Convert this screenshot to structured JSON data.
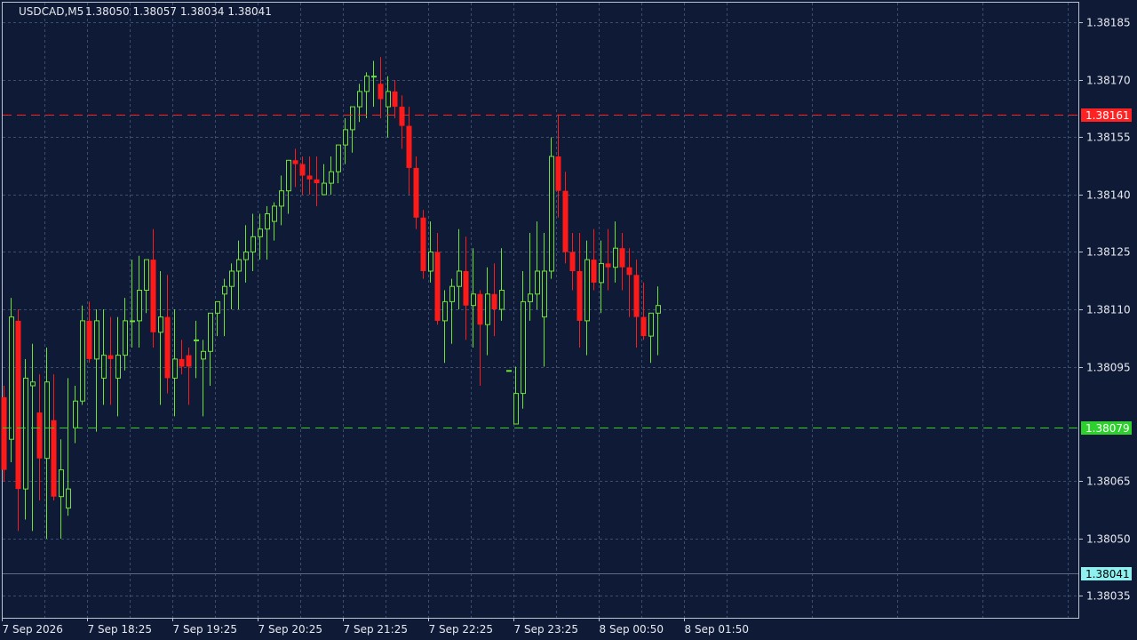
{
  "header": {
    "symbol_timeframe": "USDCAD,M5",
    "ohlc": "1.38050 1.38057 1.38034 1.38041"
  },
  "colors": {
    "background": "#0f1a36",
    "grid": "#3a4f6e",
    "frame": "#b8c4d0",
    "bull": "#6fe23a",
    "bear": "#ff1a1a",
    "ask_line": "#ff2222",
    "bid_line": "#2ed02e",
    "last_label": "#8ff0f0"
  },
  "chart_data": {
    "type": "candlestick",
    "symbol": "USDCAD",
    "timeframe": "M5",
    "ylim": [
      1.3803,
      1.3819
    ],
    "y_ticks": [
      "1.38185",
      "1.38170",
      "1.38155",
      "1.38140",
      "1.38125",
      "1.38110",
      "1.38095",
      "1.38065",
      "1.38050",
      "1.38035"
    ],
    "x_ticks": [
      {
        "bar": 0,
        "label": "7 Sep 2026"
      },
      {
        "bar": 12,
        "label": "7 Sep 18:25"
      },
      {
        "bar": 24,
        "label": "7 Sep 19:25"
      },
      {
        "bar": 36,
        "label": "7 Sep 20:25"
      },
      {
        "bar": 48,
        "label": "7 Sep 21:25"
      },
      {
        "bar": 60,
        "label": "7 Sep 22:25"
      },
      {
        "bar": 72,
        "label": "7 Sep 23:25"
      },
      {
        "bar": 84,
        "label": "8 Sep 00:50"
      },
      {
        "bar": 96,
        "label": "8 Sep 01:50"
      }
    ],
    "price_lines": [
      {
        "name": "ask",
        "value": 1.38161,
        "label": "1.38161"
      },
      {
        "name": "bid",
        "value": 1.38079,
        "label": "1.38079"
      },
      {
        "name": "last",
        "value": 1.38041,
        "label": "1.38041"
      }
    ],
    "candles": [
      [
        1.38087,
        1.3809,
        1.38065,
        1.38068
      ],
      [
        1.38076,
        1.38113,
        1.3807,
        1.38108
      ],
      [
        1.38107,
        1.3811,
        1.38052,
        1.38063
      ],
      [
        1.38063,
        1.38097,
        1.38055,
        1.38092
      ],
      [
        1.3809,
        1.38101,
        1.38052,
        1.38091
      ],
      [
        1.38083,
        1.38093,
        1.3806,
        1.38071
      ],
      [
        1.38071,
        1.381,
        1.3805,
        1.38091
      ],
      [
        1.38081,
        1.38093,
        1.3806,
        1.38061
      ],
      [
        1.38061,
        1.38076,
        1.3805,
        1.38068
      ],
      [
        1.38058,
        1.38092,
        1.38056,
        1.38063
      ],
      [
        1.38079,
        1.3809,
        1.38075,
        1.38086
      ],
      [
        1.38086,
        1.38111,
        1.38085,
        1.38107
      ],
      [
        1.38107,
        1.38112,
        1.38096,
        1.38097
      ],
      [
        1.38097,
        1.3811,
        1.38078,
        1.38107
      ],
      [
        1.38092,
        1.3811,
        1.38085,
        1.38098
      ],
      [
        1.38098,
        1.38108,
        1.38085,
        1.38097
      ],
      [
        1.38092,
        1.38108,
        1.38082,
        1.38098
      ],
      [
        1.38098,
        1.38113,
        1.38094,
        1.38107
      ],
      [
        1.38107,
        1.38123,
        1.381,
        1.38107
      ],
      [
        1.38107,
        1.38124,
        1.381,
        1.38115
      ],
      [
        1.38115,
        1.38122,
        1.38109,
        1.38123
      ],
      [
        1.38123,
        1.38131,
        1.381,
        1.38104
      ],
      [
        1.38104,
        1.3812,
        1.38085,
        1.38108
      ],
      [
        1.38108,
        1.38119,
        1.38088,
        1.38092
      ],
      [
        1.38092,
        1.3811,
        1.38082,
        1.38097
      ],
      [
        1.38097,
        1.38102,
        1.38093,
        1.38095
      ],
      [
        1.38098,
        1.381,
        1.38085,
        1.38095
      ],
      [
        1.38102,
        1.38107,
        1.38092,
        1.38102
      ],
      [
        1.38097,
        1.38102,
        1.38082,
        1.38099
      ],
      [
        1.38099,
        1.38109,
        1.3809,
        1.38109
      ],
      [
        1.38109,
        1.38112,
        1.38103,
        1.38112
      ],
      [
        1.38114,
        1.38118,
        1.38103,
        1.38116
      ],
      [
        1.38116,
        1.38122,
        1.3811,
        1.3812
      ],
      [
        1.3812,
        1.38128,
        1.3811,
        1.38123
      ],
      [
        1.38123,
        1.38132,
        1.38117,
        1.38125
      ],
      [
        1.38125,
        1.38135,
        1.3812,
        1.38129
      ],
      [
        1.38129,
        1.38135,
        1.38123,
        1.38131
      ],
      [
        1.38131,
        1.38137,
        1.38123,
        1.38135
      ],
      [
        1.38133,
        1.38138,
        1.38128,
        1.38137
      ],
      [
        1.38137,
        1.38145,
        1.38132,
        1.38141
      ],
      [
        1.38141,
        1.38149,
        1.38135,
        1.38149
      ],
      [
        1.38149,
        1.38152,
        1.38142,
        1.38148
      ],
      [
        1.38148,
        1.3815,
        1.3814,
        1.38145
      ],
      [
        1.38145,
        1.3815,
        1.3814,
        1.38144
      ],
      [
        1.38144,
        1.3815,
        1.38137,
        1.38143
      ],
      [
        1.3814,
        1.38148,
        1.3814,
        1.38143
      ],
      [
        1.38143,
        1.3815,
        1.3814,
        1.38146
      ],
      [
        1.38146,
        1.38153,
        1.38143,
        1.38153
      ],
      [
        1.38153,
        1.3816,
        1.38148,
        1.38157
      ],
      [
        1.38157,
        1.38163,
        1.38151,
        1.38163
      ],
      [
        1.38163,
        1.38169,
        1.38159,
        1.38167
      ],
      [
        1.38167,
        1.38172,
        1.3816,
        1.38171
      ],
      [
        1.38171,
        1.38175,
        1.38163,
        1.38171
      ],
      [
        1.38169,
        1.38176,
        1.3816,
        1.38165
      ],
      [
        1.38163,
        1.38171,
        1.38155,
        1.38167
      ],
      [
        1.38167,
        1.3817,
        1.3816,
        1.38163
      ],
      [
        1.38163,
        1.38166,
        1.38152,
        1.38158
      ],
      [
        1.38158,
        1.38163,
        1.3814,
        1.38147
      ],
      [
        1.38147,
        1.3815,
        1.38131,
        1.38134
      ],
      [
        1.38134,
        1.38136,
        1.38118,
        1.3812
      ],
      [
        1.3812,
        1.38133,
        1.38117,
        1.38125
      ],
      [
        1.38125,
        1.3813,
        1.38106,
        1.38107
      ],
      [
        1.38107,
        1.38115,
        1.38096,
        1.38112
      ],
      [
        1.38112,
        1.38118,
        1.38101,
        1.38116
      ],
      [
        1.38116,
        1.38131,
        1.3811,
        1.3812
      ],
      [
        1.3812,
        1.38129,
        1.38102,
        1.38111
      ],
      [
        1.38111,
        1.38126,
        1.381,
        1.38114
      ],
      [
        1.38114,
        1.38115,
        1.3809,
        1.38106
      ],
      [
        1.38106,
        1.38121,
        1.38098,
        1.38114
      ],
      [
        1.38114,
        1.38122,
        1.38103,
        1.3811
      ],
      [
        1.3811,
        1.38126,
        1.38107,
        1.38115
      ],
      [
        1.38094,
        1.38094,
        1.38094,
        1.38094
      ],
      [
        1.3808,
        1.38095,
        1.3808,
        1.38088
      ],
      [
        1.38088,
        1.3812,
        1.38084,
        1.38112
      ],
      [
        1.38112,
        1.3813,
        1.38107,
        1.38114
      ],
      [
        1.38114,
        1.38133,
        1.3811,
        1.3812
      ],
      [
        1.38108,
        1.3813,
        1.38095,
        1.3812
      ],
      [
        1.3812,
        1.38155,
        1.38118,
        1.3815
      ],
      [
        1.3815,
        1.38161,
        1.38134,
        1.38141
      ],
      [
        1.38141,
        1.38146,
        1.38122,
        1.38125
      ],
      [
        1.38125,
        1.3813,
        1.38115,
        1.3812
      ],
      [
        1.3812,
        1.3813,
        1.381,
        1.38107
      ],
      [
        1.38107,
        1.38128,
        1.38098,
        1.38123
      ],
      [
        1.38123,
        1.38131,
        1.38115,
        1.38117
      ],
      [
        1.38117,
        1.38128,
        1.38109,
        1.38122
      ],
      [
        1.38122,
        1.38131,
        1.38115,
        1.38121
      ],
      [
        1.38121,
        1.38133,
        1.38117,
        1.38126
      ],
      [
        1.38126,
        1.3813,
        1.38115,
        1.38121
      ],
      [
        1.38121,
        1.38126,
        1.38108,
        1.38119
      ],
      [
        1.38119,
        1.38123,
        1.381,
        1.38108
      ],
      [
        1.38108,
        1.38117,
        1.38102,
        1.38103
      ],
      [
        1.38103,
        1.38109,
        1.38096,
        1.38109
      ],
      [
        1.38109,
        1.38116,
        1.38098,
        1.38111
      ]
    ]
  }
}
